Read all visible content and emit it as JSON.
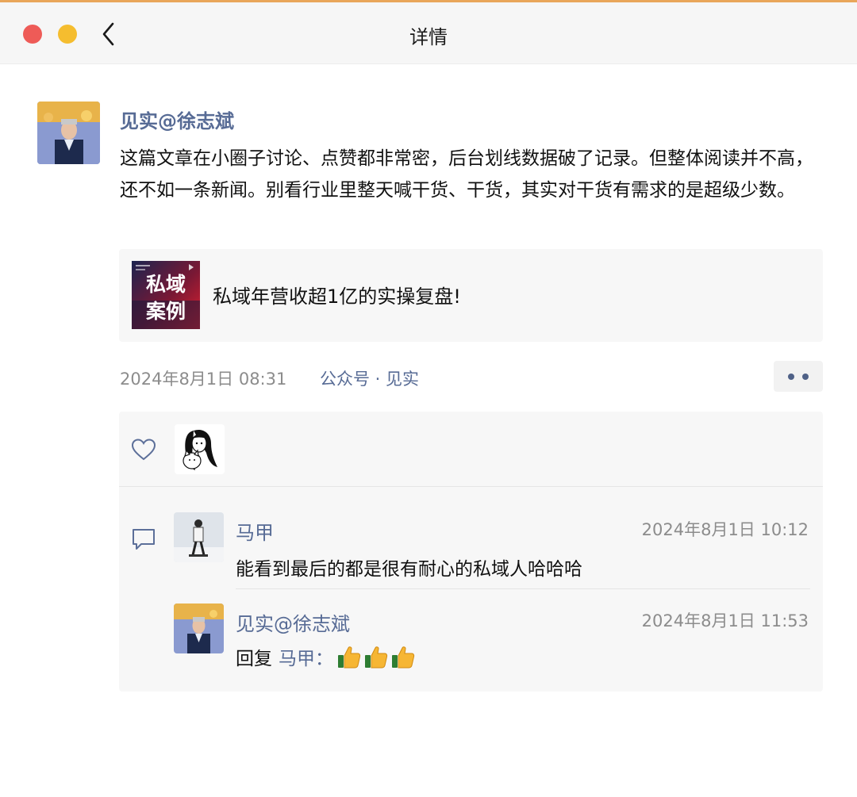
{
  "window": {
    "title": "详情"
  },
  "post": {
    "author": "见实@徐志斌",
    "text": "这篇文章在小圈子讨论、点赞都非常密，后台划线数据破了记录。但整体阅读并不高，还不如一条新闻。别看行业里整天喊干货、干货，其实对干货有需求的是超级少数。",
    "share": {
      "thumb_line1": "私域",
      "thumb_line2": "案例",
      "title": "私域年营收超1亿的实操复盘!"
    },
    "time": "2024年8月1日 08:31",
    "source": "公众号 · 见实"
  },
  "comments": [
    {
      "name": "马甲",
      "time": "2024年8月1日 10:12",
      "text": "能看到最后的都是很有耐心的私域人哈哈哈"
    },
    {
      "name": "见实@徐志斌",
      "time": "2024年8月1日 11:53",
      "reply_prefix": "回复",
      "reply_to": "马甲：",
      "emoji": "thumbs-up x3"
    }
  ],
  "colors": {
    "link": "#576b95",
    "meta": "#8c8c8c",
    "panel": "#f7f7f7",
    "red": "#ee5b57",
    "yellow": "#f5bd2f"
  }
}
